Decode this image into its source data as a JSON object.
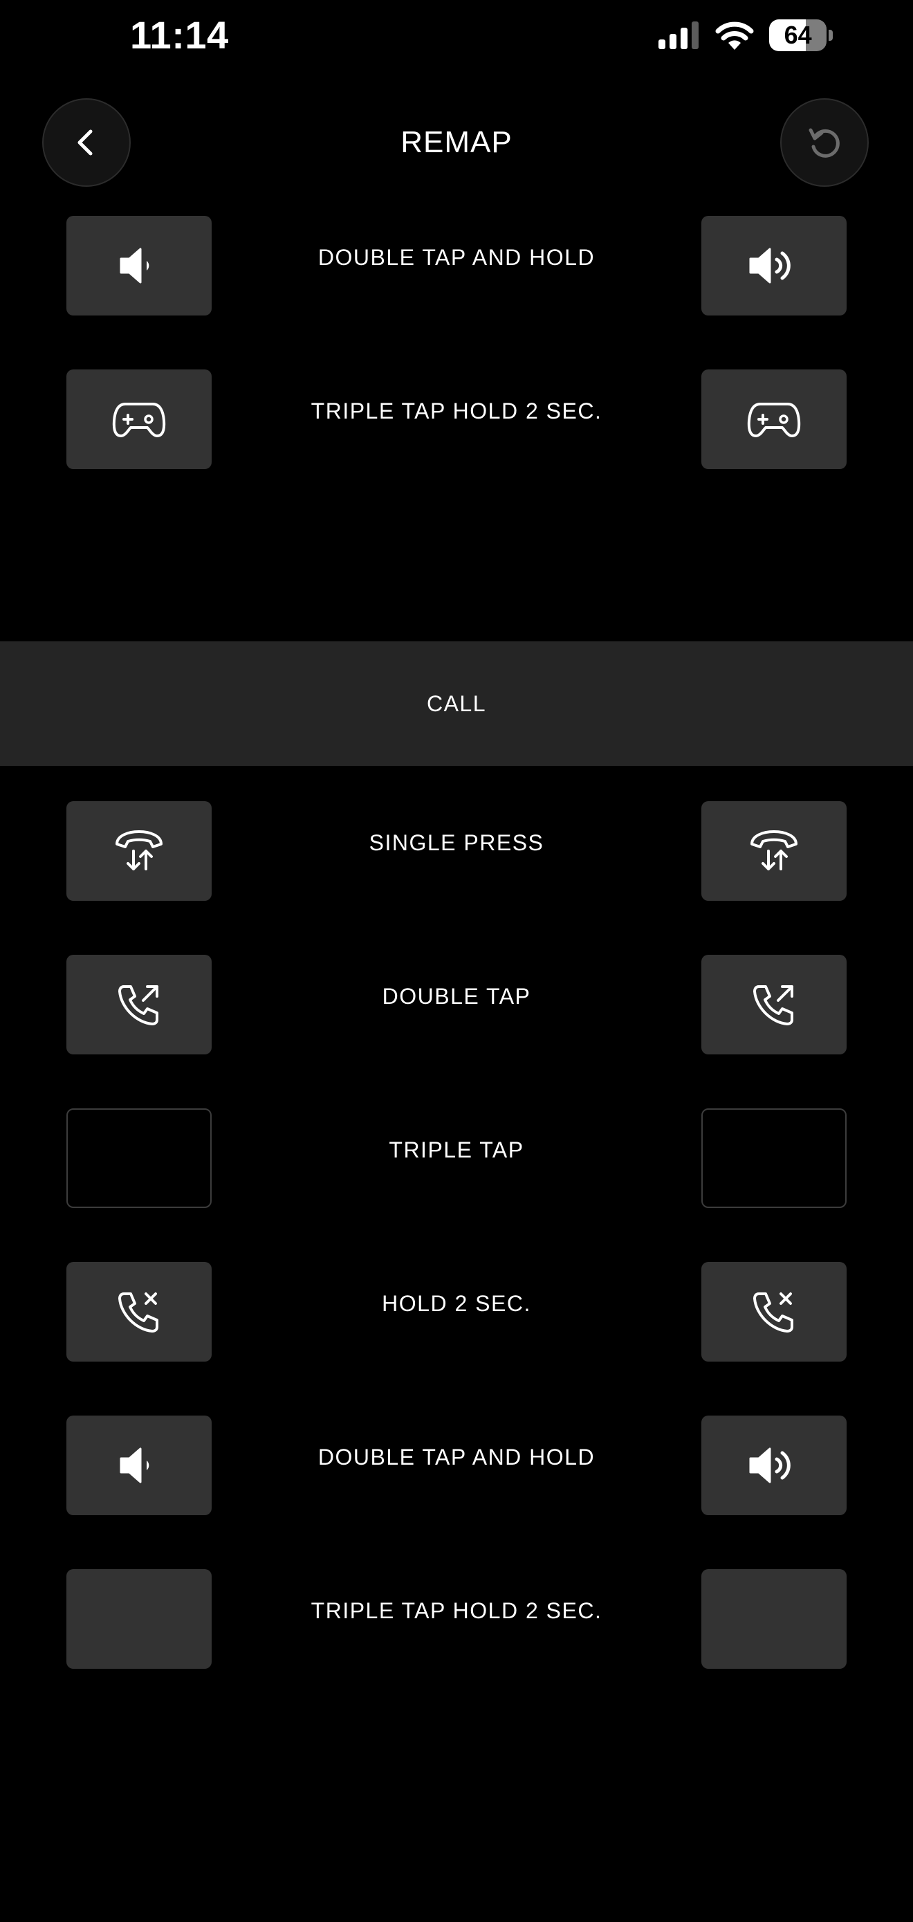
{
  "status_bar": {
    "time": "11:14",
    "battery_level": "64",
    "icons": [
      "cellular-signal-icon",
      "wifi-icon",
      "battery-icon"
    ]
  },
  "header": {
    "title": "REMAP",
    "back_icon": "chevron-left-icon",
    "reset_icon": "reset-icon"
  },
  "top_rows": [
    {
      "label": "DOUBLE TAP AND HOLD",
      "left_icon": "volume-down-icon",
      "right_icon": "volume-up-icon"
    },
    {
      "label": "TRIPLE TAP HOLD 2 SEC.",
      "left_icon": "gamepad-icon",
      "right_icon": "gamepad-icon"
    }
  ],
  "call_section": {
    "title": "CALL",
    "rows": [
      {
        "label": "SINGLE PRESS",
        "left_icon": "answer-end-call-icon",
        "right_icon": "answer-end-call-icon"
      },
      {
        "label": "DOUBLE TAP",
        "left_icon": "outgoing-call-icon",
        "right_icon": "outgoing-call-icon"
      },
      {
        "label": "TRIPLE TAP",
        "left_icon": "none",
        "right_icon": "none"
      },
      {
        "label": "HOLD 2 SEC.",
        "left_icon": "reject-call-icon",
        "right_icon": "reject-call-icon"
      },
      {
        "label": "DOUBLE TAP AND HOLD",
        "left_icon": "volume-down-icon",
        "right_icon": "volume-up-icon"
      },
      {
        "label": "TRIPLE TAP HOLD 2 SEC.",
        "left_icon": "none",
        "right_icon": "none"
      }
    ]
  },
  "colors": {
    "background": "#000000",
    "tile": "#333333",
    "section_band": "#252525",
    "text": "#ffffff"
  }
}
